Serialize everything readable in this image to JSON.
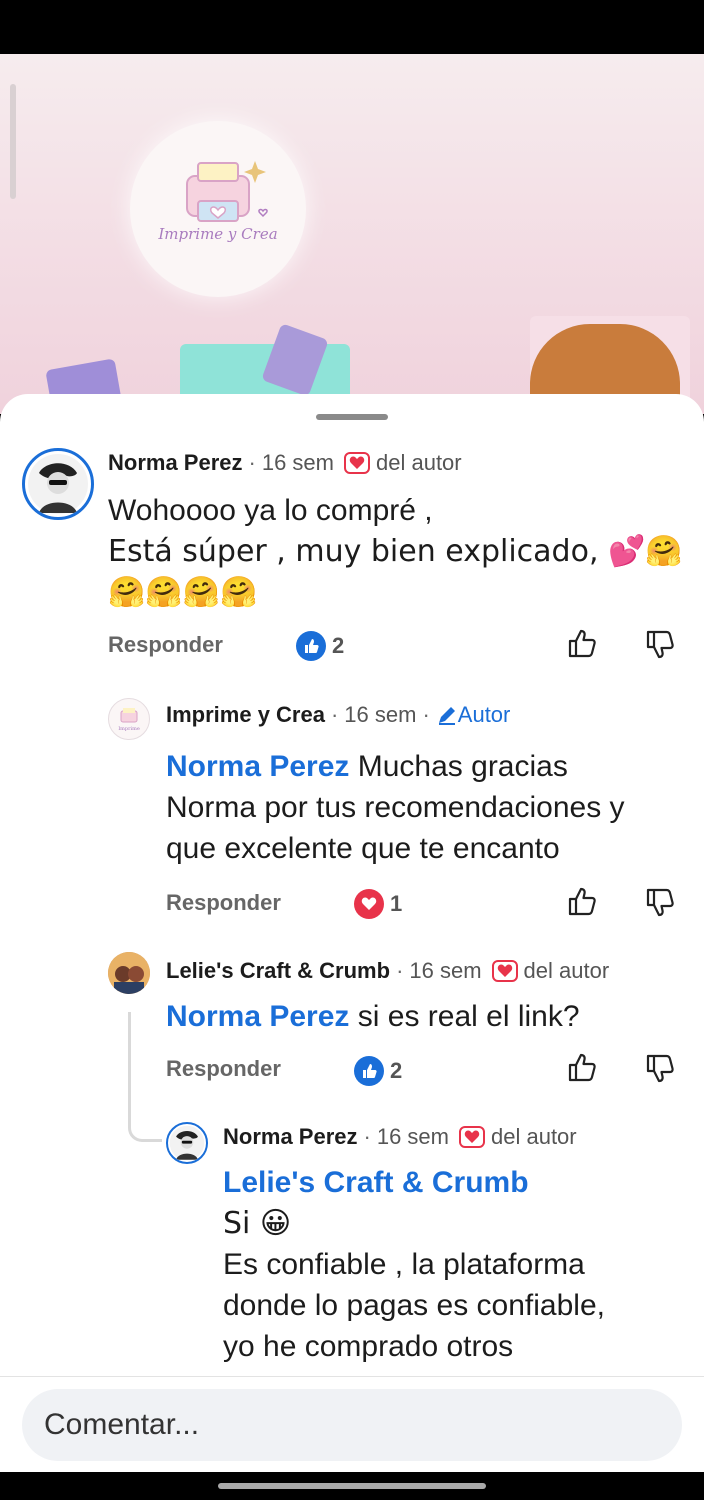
{
  "video": {
    "logo_text": "Imprime y Crea"
  },
  "comments": [
    {
      "author": "Norma Perez",
      "time": "16 sem",
      "badge": "del autor",
      "lines": [
        "Wohoooo ya lo compré ,",
        "Está súper , muy bien explicado, 💕🤗",
        "🤗🤗🤗🤗"
      ],
      "reply_label": "Responder",
      "reaction_count": "2"
    },
    {
      "author": "Imprime y Crea",
      "time": "16 sem",
      "badge": "Autor",
      "mention": "Norma Perez",
      "lines": [
        " Muchas gracias",
        "Norma por tus recomendaciones y",
        "que excelente que te encanto"
      ],
      "reply_label": "Responder",
      "reaction_count": "1"
    },
    {
      "author": "Lelie's Craft & Crumb",
      "time": "16 sem",
      "badge": "del autor",
      "mention": "Norma Perez",
      "lines": [
        " si es real el link?"
      ],
      "reply_label": "Responder",
      "reaction_count": "2"
    },
    {
      "author": "Norma Perez",
      "time": "16 sem",
      "badge": "del autor",
      "mention": "Lelie's Craft & Crumb",
      "lines": [
        "Si 😀",
        "Es confiable , la plataforma",
        "donde lo pagas es confiable,",
        "yo he comprado otros"
      ]
    }
  ],
  "composer": {
    "placeholder": "Comentar..."
  },
  "colors": {
    "link": "#1a6ed8",
    "heart": "#e8334a",
    "like": "#1a6ed8"
  }
}
